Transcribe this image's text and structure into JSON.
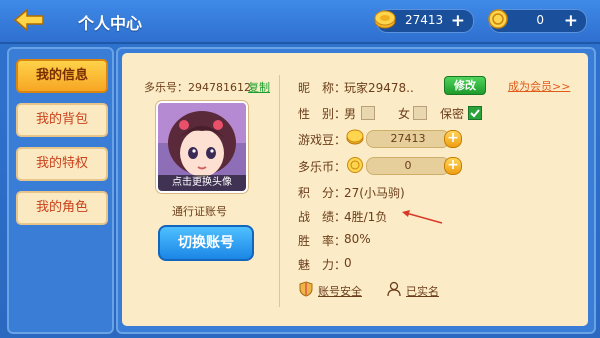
{
  "header": {
    "title": "个人中心",
    "coins": "27413",
    "coins_plus": "+",
    "duole": "0",
    "duole_plus": "+"
  },
  "sidebar": {
    "items": [
      {
        "label": "我的信息",
        "active": true
      },
      {
        "label": "我的背包",
        "active": false
      },
      {
        "label": "我的特权",
        "active": false
      },
      {
        "label": "我的角色",
        "active": false
      }
    ]
  },
  "profile": {
    "id_label": "多乐号：294781612",
    "copy": "复制",
    "avatar_caption": "点击更换头像",
    "account_type": "通行证账号",
    "switch_account": "切换账号"
  },
  "info": {
    "nickname_label": "昵　称：",
    "nickname": "玩家29478..",
    "edit": "修改",
    "vip": "成为会员>>",
    "gender_label": "性　别：",
    "male": "男",
    "female": "女",
    "secret": "保密",
    "beans_label": "游戏豆：",
    "beans": "27413",
    "duole_label": "多乐币：",
    "duole": "0",
    "score_label": "积　分：",
    "score": "27(小马驹)",
    "record_label": "战　绩：",
    "record": "4胜/1负",
    "winrate_label": "胜　率：",
    "winrate": "80%",
    "charm_label": "魅　力：",
    "charm": "0",
    "security": "账号安全",
    "realname": "已实名"
  },
  "colors": {
    "accent_green": "#18a02e",
    "vip_orange": "#e25a1a",
    "panel_bg": "#fbecc7"
  }
}
